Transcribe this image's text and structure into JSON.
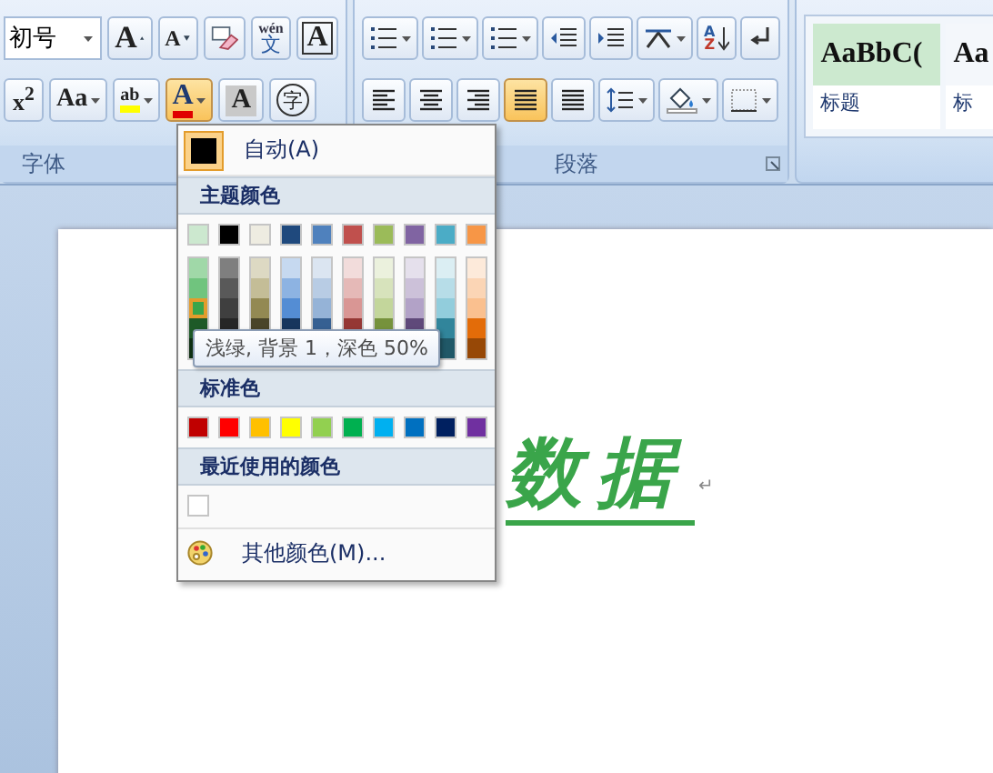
{
  "ribbon": {
    "font_group": {
      "label": "字体",
      "font_size": {
        "value": "初号"
      },
      "row1": [
        {
          "kind": "grow",
          "text": "A",
          "on": false
        },
        {
          "kind": "shrink",
          "text": "A",
          "on": false
        },
        {
          "kind": "clear",
          "on": false
        },
        {
          "kind": "phonetic",
          "pinyin": "wén",
          "text": "文",
          "on": false
        },
        {
          "kind": "border",
          "text": "A",
          "on": false
        }
      ],
      "row2": [
        {
          "kind": "superscript",
          "text": "x$^{2}$",
          "on": false
        },
        {
          "kind": "case",
          "text": "Aa",
          "on": false
        },
        {
          "kind": "highlight",
          "text": "ab",
          "on": false
        },
        {
          "kind": "fontcolor",
          "text": "A",
          "on": true
        },
        {
          "kind": "shading",
          "text": "A",
          "on": false
        },
        {
          "kind": "enclose",
          "text": "字",
          "on": false
        }
      ]
    },
    "paragraph_group": {
      "label": "段落",
      "row1": [
        {
          "kind": "bullets",
          "on": false
        },
        {
          "kind": "numbering",
          "on": false
        },
        {
          "kind": "multilevel",
          "on": false
        },
        {
          "kind": "outdent",
          "on": false
        },
        {
          "kind": "indent",
          "on": false
        },
        {
          "kind": "asian",
          "on": false
        },
        {
          "kind": "sort",
          "text": "A",
          "text2": "Z",
          "on": false
        },
        {
          "kind": "marks",
          "on": false
        }
      ],
      "row2": [
        {
          "kind": "left",
          "on": false
        },
        {
          "kind": "center",
          "on": false
        },
        {
          "kind": "right",
          "on": false
        },
        {
          "kind": "justify",
          "on": true
        },
        {
          "kind": "distributed",
          "on": false
        },
        {
          "kind": "spacing",
          "on": false
        },
        {
          "kind": "fill",
          "on": false
        },
        {
          "kind": "borders",
          "on": false
        }
      ]
    },
    "styles": [
      {
        "sample": "AaBbC(",
        "name": "标题",
        "selected": true
      },
      {
        "sample": "Aa",
        "name": "标",
        "selected": false
      }
    ]
  },
  "document": {
    "text": "数据",
    "color": "#3aa54a",
    "mark": "↵"
  },
  "color_menu": {
    "automatic": {
      "label": "自动(A)",
      "color": "#000000",
      "selected": true
    },
    "theme_header": "主题颜色",
    "theme_colors": [
      {
        "color": "#cce8cf",
        "selected": false,
        "shades": [
          {
            "color": "#a0d8a8",
            "selected": false
          },
          {
            "color": "#70c47e",
            "selected": false
          },
          {
            "color": "#3aa54a",
            "selected": true
          },
          {
            "color": "#1e5a28",
            "selected": false
          },
          {
            "color": "#0f3014",
            "selected": false
          }
        ]
      },
      {
        "color": "#000000",
        "selected": false,
        "shades": [
          {
            "color": "#7f7f7f",
            "selected": false
          },
          {
            "color": "#595959",
            "selected": false
          },
          {
            "color": "#3f3f3f",
            "selected": false
          },
          {
            "color": "#262626",
            "selected": false
          }
        ]
      },
      {
        "color": "#eeece1",
        "selected": false,
        "shades": [
          {
            "color": "#ddd9c3",
            "selected": false
          },
          {
            "color": "#c4bd97",
            "selected": false
          },
          {
            "color": "#938953",
            "selected": false
          },
          {
            "color": "#494429",
            "selected": false
          }
        ]
      },
      {
        "color": "#1f497d",
        "selected": false,
        "shades": [
          {
            "color": "#c6d9f0",
            "selected": false
          },
          {
            "color": "#8db3e2",
            "selected": false
          },
          {
            "color": "#548dd4",
            "selected": false
          },
          {
            "color": "#17365d",
            "selected": false
          }
        ]
      },
      {
        "color": "#4f81bd",
        "selected": false,
        "shades": [
          {
            "color": "#dbe5f1",
            "selected": false
          },
          {
            "color": "#b8cce4",
            "selected": false
          },
          {
            "color": "#95b3d7",
            "selected": false
          },
          {
            "color": "#366092",
            "selected": false
          }
        ]
      },
      {
        "color": "#c0504d",
        "selected": false,
        "shades": [
          {
            "color": "#f2dcdb",
            "selected": false
          },
          {
            "color": "#e5b9b7",
            "selected": false
          },
          {
            "color": "#d99694",
            "selected": false
          },
          {
            "color": "#953734",
            "selected": false
          }
        ]
      },
      {
        "color": "#9bbb59",
        "selected": false,
        "shades": [
          {
            "color": "#ebf1dd",
            "selected": false
          },
          {
            "color": "#d7e3bc",
            "selected": false
          },
          {
            "color": "#c3d69b",
            "selected": false
          },
          {
            "color": "#76923c",
            "selected": false
          }
        ]
      },
      {
        "color": "#8064a2",
        "selected": false,
        "shades": [
          {
            "color": "#e5e0ec",
            "selected": false
          },
          {
            "color": "#ccc1d9",
            "selected": false
          },
          {
            "color": "#b2a2c7",
            "selected": false
          },
          {
            "color": "#5f497a",
            "selected": false
          }
        ]
      },
      {
        "color": "#4bacc6",
        "selected": false,
        "shades": [
          {
            "color": "#dbeef3",
            "selected": false
          },
          {
            "color": "#b7dde8",
            "selected": false
          },
          {
            "color": "#92cddc",
            "selected": false
          },
          {
            "color": "#31859b",
            "selected": false
          },
          {
            "color": "#205867",
            "selected": false
          }
        ]
      },
      {
        "color": "#f79646",
        "selected": false,
        "shades": [
          {
            "color": "#fdeada",
            "selected": false
          },
          {
            "color": "#fbd5b5",
            "selected": false
          },
          {
            "color": "#fac08f",
            "selected": false
          },
          {
            "color": "#e36c09",
            "selected": false
          },
          {
            "color": "#974806",
            "selected": false
          }
        ]
      }
    ],
    "tooltip": "浅绿, 背景 1，深色 50%",
    "standard_header": "标准色",
    "standard_colors": [
      {
        "color": "#c00000",
        "selected": false
      },
      {
        "color": "#ff0000",
        "selected": false
      },
      {
        "color": "#ffc000",
        "selected": false
      },
      {
        "color": "#ffff00",
        "selected": false
      },
      {
        "color": "#92d050",
        "selected": false
      },
      {
        "color": "#00b050",
        "selected": false
      },
      {
        "color": "#00b0f0",
        "selected": false
      },
      {
        "color": "#0070c0",
        "selected": false
      },
      {
        "color": "#002060",
        "selected": false
      },
      {
        "color": "#7030a0",
        "selected": false
      }
    ],
    "recent_header": "最近使用的颜色",
    "recent_colors": [
      {
        "color": "#ffffff",
        "selected": false
      }
    ],
    "more": "其他颜色(M)..."
  }
}
